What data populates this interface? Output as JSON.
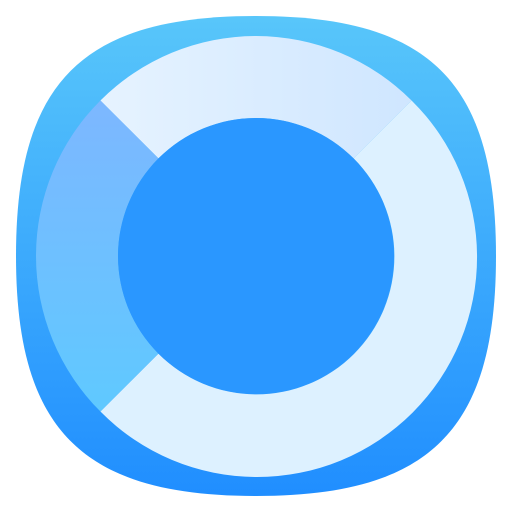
{
  "app_icon": {
    "icon_name": "ring-donut-icon",
    "colors": {
      "background_top": "#5AC8FA",
      "background_bottom": "#1E8CFF",
      "ring_top_light": "#E6F3FF",
      "ring_top_right": "#CFE6FF",
      "ring_left_top": "#7DB7FF",
      "ring_left_bottom": "#5FC9FF",
      "ring_main": "#DDF1FF",
      "center": "#2A97FF"
    }
  }
}
